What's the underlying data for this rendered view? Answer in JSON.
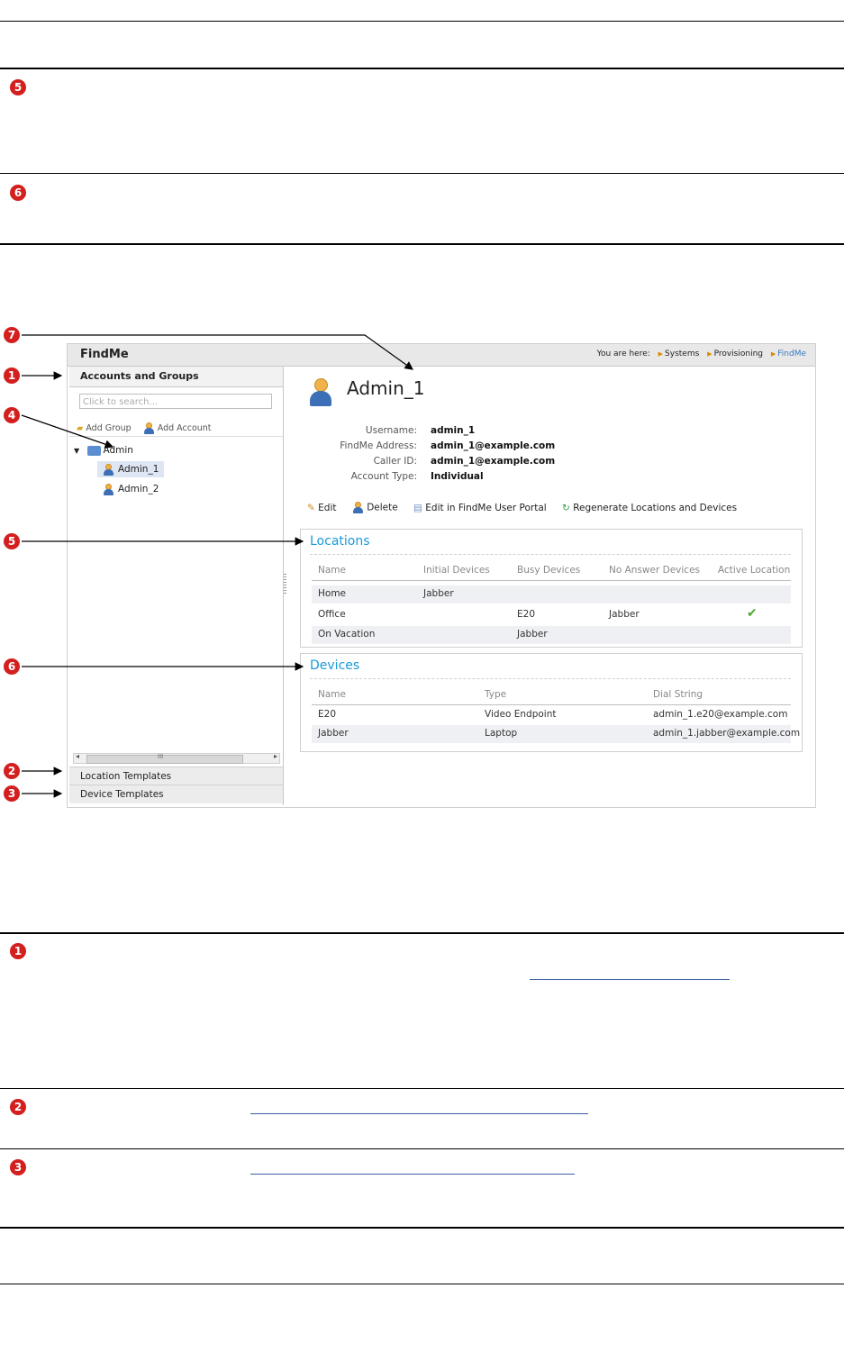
{
  "callouts": {
    "one": "1",
    "two": "2",
    "three": "3",
    "four": "4",
    "five": "5",
    "six": "6",
    "seven": "7"
  },
  "screenshot": {
    "app_title": "FindMe",
    "breadcrumb": {
      "prefix": "You are here:",
      "items": [
        "Systems",
        "Provisioning",
        "FindMe"
      ]
    },
    "left_pane": {
      "header": "Accounts and Groups",
      "search_placeholder": "Click to search...",
      "add_group": "Add Group",
      "add_account": "Add Account",
      "tree": {
        "root": "Admin",
        "children": [
          "Admin_1",
          "Admin_2"
        ]
      },
      "scroll_mark": "III",
      "location_templates": "Location Templates",
      "device_templates": "Device Templates"
    },
    "account": {
      "name": "Admin_1",
      "fields": [
        {
          "label": "Username:",
          "value": "admin_1"
        },
        {
          "label": "FindMe Address:",
          "value": "admin_1@example.com"
        },
        {
          "label": "Caller ID:",
          "value": "admin_1@example.com"
        },
        {
          "label": "Account Type:",
          "value": "Individual"
        }
      ],
      "actions": [
        "Edit",
        "Delete",
        "Edit in FindMe User Portal",
        "Regenerate Locations and Devices"
      ]
    },
    "locations": {
      "title": "Locations",
      "columns": [
        "Name",
        "Initial Devices",
        "Busy Devices",
        "No Answer Devices",
        "Active Location"
      ],
      "rows": [
        [
          "Home",
          "Jabber",
          "",
          "",
          ""
        ],
        [
          "Office",
          "",
          "E20",
          "Jabber",
          "✔"
        ],
        [
          "On Vacation",
          "",
          "Jabber",
          "",
          ""
        ]
      ]
    },
    "devices": {
      "title": "Devices",
      "columns": [
        "Name",
        "Type",
        "Dial String"
      ],
      "rows": [
        [
          "E20",
          "Video Endpoint",
          "admin_1.e20@example.com"
        ],
        [
          "Jabber",
          "Laptop",
          "admin_1.jabber@example.com"
        ]
      ]
    }
  }
}
